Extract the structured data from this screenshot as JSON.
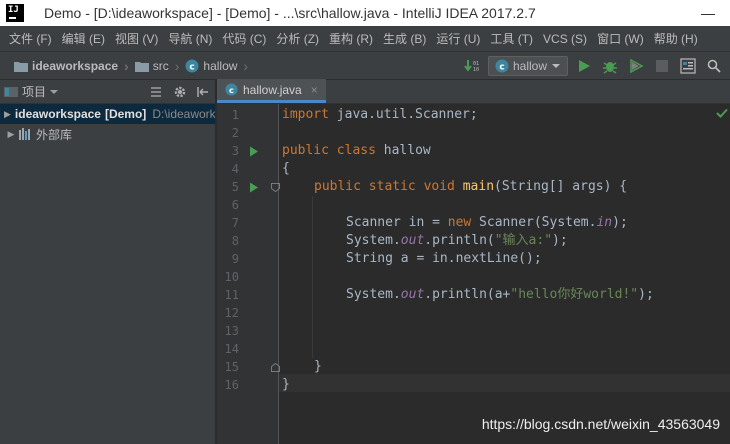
{
  "window": {
    "title": "Demo - [D:\\ideaworkspace] - [Demo] - ...\\src\\hallow.java - IntelliJ IDEA 2017.2.7",
    "logo_text": "IJ",
    "minimize_glyph": "—"
  },
  "menu": [
    "文件 (F)",
    "编辑 (E)",
    "视图 (V)",
    "导航 (N)",
    "代码 (C)",
    "分析 (Z)",
    "重构 (R)",
    "生成 (B)",
    "运行 (U)",
    "工具 (T)",
    "VCS (S)",
    "窗口 (W)",
    "帮助 (H)"
  ],
  "breadcrumb": {
    "items": [
      {
        "label": "ideaworkspace",
        "icon": "folder-icon"
      },
      {
        "label": "src",
        "icon": "folder-icon"
      },
      {
        "label": "hallow",
        "icon": "java-class-icon"
      }
    ],
    "separator": "›"
  },
  "run_config": {
    "label": "hallow"
  },
  "project_panel": {
    "title": "项目",
    "tree": [
      {
        "label": "ideaworkspace",
        "module": "[Demo]",
        "path": "D:\\ideaworkspace",
        "icon": "module-folder-icon",
        "selected": true
      },
      {
        "label": "外部库",
        "icon": "library-icon",
        "selected": false
      }
    ]
  },
  "editor": {
    "tab": {
      "label": "hallow.java",
      "close_glyph": "×"
    },
    "line_numbers": [
      "1",
      "2",
      "3",
      "4",
      "5",
      "6",
      "7",
      "8",
      "9",
      "10",
      "11",
      "12",
      "13",
      "14",
      "15",
      "16"
    ],
    "current_line": 16,
    "code_text": {
      "l1_import": "import",
      "l1_rest": " java.util.Scanner;",
      "l3_public": "public",
      "l3_class": "class",
      "l3_name": " hallow",
      "l4": "{",
      "l5_mods": "public static void",
      "l5_main": "main",
      "l5_rest": "(String[] args) {",
      "l7_a": "Scanner in = ",
      "l7_new": "new",
      "l7_b": " Scanner(System.",
      "l7_in": "in",
      "l7_c": ");",
      "l8_a": "System.",
      "l8_out": "out",
      "l8_b": ".println(",
      "l8_str": "\"输入a:\"",
      "l8_c": ");",
      "l9": "String a = in.nextLine();",
      "l11_a": "System.",
      "l11_out": "out",
      "l11_b": ".println(a+",
      "l11_str": "\"hello你好world!\"",
      "l11_c": ");",
      "l15": "}",
      "l16": "}"
    }
  },
  "watermark": "https://blog.csdn.net/weixin_43563049",
  "colors": {
    "keyword": "#cc7832",
    "string": "#6a8759",
    "field": "#9876aa",
    "method": "#ffc66d",
    "run_green": "#499c54",
    "selection": "#0d293e"
  }
}
